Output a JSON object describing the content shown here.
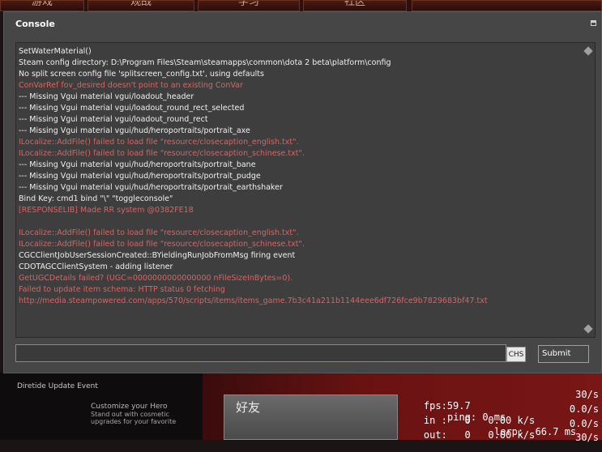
{
  "background": {
    "nav_tabs": [
      "游戏",
      "观战",
      "学习",
      "社区"
    ],
    "event_title": "Diretide Update Event",
    "promo": {
      "title": "Customize your Hero",
      "subtitle": "Stand out with cosmetic upgrades for your favorite"
    },
    "friends_label": "好友",
    "netgraph": {
      "fps": "fps:59.7",
      "ping": "ping: 0 ms",
      "fps_right": "30/s",
      "in_row": "in :   0   0.00 k/s",
      "lerp": "lerp:  66.7 ms",
      "in_right": "0.0/s",
      "out_row": "out:   0   0.00 k/s",
      "out_right": "0.0/s",
      "extra_right": "30/s"
    }
  },
  "console": {
    "title": "Console",
    "lines": [
      {
        "text": "SetWaterMaterial()",
        "color": "#f0f0f0"
      },
      {
        "text": "Steam config directory: D:\\Program Files\\Steam\\steamapps\\common\\dota 2 beta\\platform\\config",
        "color": "#f0f0f0"
      },
      {
        "text": "No split screen config file 'splitscreen_config.txt', using defaults",
        "color": "#f0f0f0"
      },
      {
        "text": "ConVarRef fov_desired doesn't point to an existing ConVar",
        "color": "#e06060"
      },
      {
        "text": "--- Missing Vgui material vgui/loadout_header",
        "color": "#f0f0f0"
      },
      {
        "text": "--- Missing Vgui material vgui/loadout_round_rect_selected",
        "color": "#f0f0f0"
      },
      {
        "text": "--- Missing Vgui material vgui/loadout_round_rect",
        "color": "#f0f0f0"
      },
      {
        "text": "--- Missing Vgui material vgui/hud/heroportraits/portrait_axe",
        "color": "#f0f0f0"
      },
      {
        "text": "ILocalize::AddFile() failed to load file \"resource/closecaption_english.txt\".",
        "color": "#e06060"
      },
      {
        "text": "ILocalize::AddFile() failed to load file \"resource/closecaption_schinese.txt\".",
        "color": "#e06060"
      },
      {
        "text": "--- Missing Vgui material vgui/hud/heroportraits/portrait_bane",
        "color": "#f0f0f0"
      },
      {
        "text": "--- Missing Vgui material vgui/hud/heroportraits/portrait_pudge",
        "color": "#f0f0f0"
      },
      {
        "text": "--- Missing Vgui material vgui/hud/heroportraits/portrait_earthshaker",
        "color": "#f0f0f0"
      },
      {
        "text": "Bind Key: cmd1 bind \"\\\" \"toggleconsole\"",
        "color": "#f0f0f0"
      },
      {
        "text": "[RESPONSELIB] Made RR system @0382FE18",
        "color": "#e06060"
      },
      {
        "text": "",
        "color": "#f0f0f0"
      },
      {
        "text": "ILocalize::AddFile() failed to load file \"resource/closecaption_english.txt\".",
        "color": "#e06060"
      },
      {
        "text": "ILocalize::AddFile() failed to load file \"resource/closecaption_schinese.txt\".",
        "color": "#e06060"
      },
      {
        "text": "CGCClientJobUserSessionCreated::BYieldingRunJobFromMsg firing event",
        "color": "#f0f0f0"
      },
      {
        "text": "CDOTAGCClientSystem - adding listener",
        "color": "#f0f0f0"
      },
      {
        "text": "GetUGCDetails failed? (UGC=0000000000000000 nFileSizeInBytes=0).",
        "color": "#e06060"
      },
      {
        "text": "Failed to update item schema: HTTP status 0 fetching",
        "color": "#e06060"
      },
      {
        "text": "http://media.steampowered.com/apps/570/scripts/items/items_game.7b3c41a211b1144eee6df726fce9b7829683bf47.txt",
        "color": "#e06060"
      }
    ],
    "input_value": "",
    "ime_indicator": "CHS",
    "submit_label": "Submit"
  }
}
